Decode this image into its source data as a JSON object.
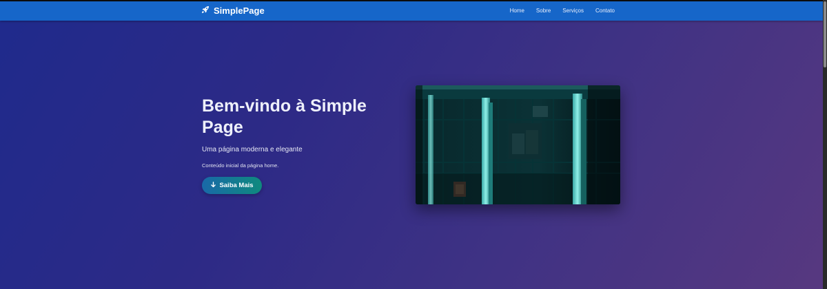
{
  "navbar": {
    "brand": "SimplePage",
    "brand_icon": "rocket-icon",
    "links": [
      "Home",
      "Sobre",
      "Serviços",
      "Contato"
    ],
    "color": "#1666c9"
  },
  "hero": {
    "title": "Bem-vindo à Simple Page",
    "subtitle": "Uma página moderna e elegante",
    "content": "Conteúdo inicial da página home.",
    "cta_label": "Saiba Mais",
    "cta_icon": "arrow-down-icon",
    "image_icon": "building-photo",
    "gradient_colors": [
      "#1f2a8c",
      "#573880"
    ]
  }
}
